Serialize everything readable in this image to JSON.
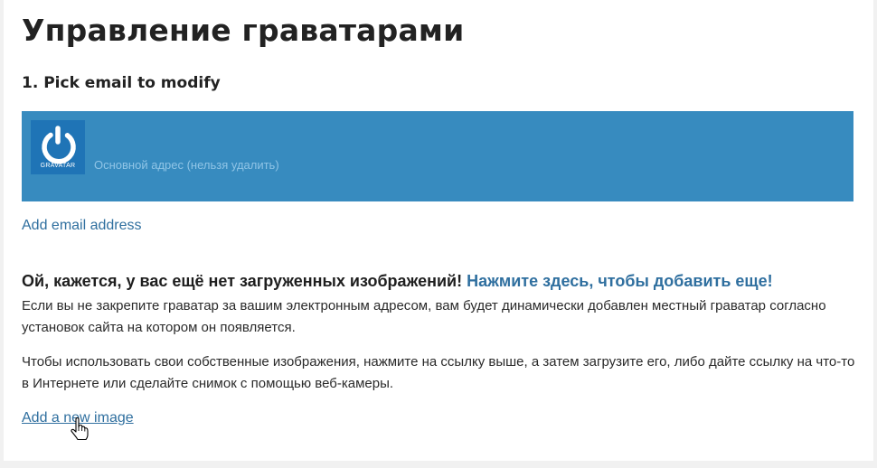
{
  "page": {
    "title": "Управление граватарами",
    "step_title": "1. Pick email to modify"
  },
  "email": {
    "avatar_logo_text": "GRAVATAR",
    "label": "Основной адрес (нельзя удалить)",
    "colors": {
      "row_bg": "#378bbf",
      "avatar_bg": "#1f74b6"
    }
  },
  "links": {
    "add_email": "Add email address",
    "add_image": "Add a new image"
  },
  "notice": {
    "heading": "Ой, кажется, у вас ещё нет загруженных изображений!",
    "cta": "Нажмите здесь, чтобы добавить еще!",
    "paragraph1": "Если вы не закрепите граватар за вашим электронным адресом, вам будет динамически добавлен местный граватар согласно установок сайта на котором он появляется.",
    "paragraph2": "Чтобы использовать свои собственные изображения, нажмите на ссылку выше, а затем загрузите его, либо дайте ссылку на что-то в Интернете или сделайте снимок с помощью веб-камеры."
  },
  "icons": {
    "avatar": "gravatar-logo-icon",
    "cursor": "hand-pointer-icon"
  }
}
